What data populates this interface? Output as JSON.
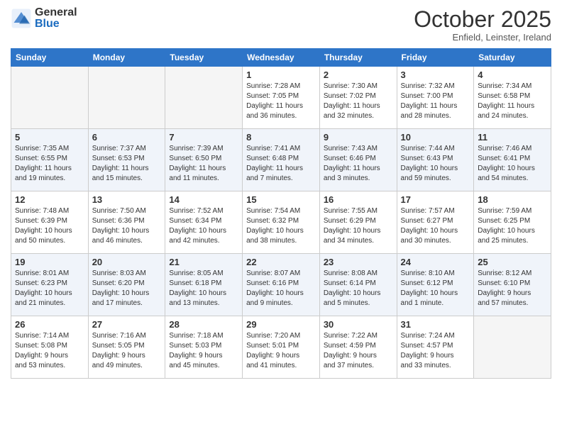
{
  "logo": {
    "general": "General",
    "blue": "Blue"
  },
  "title": "October 2025",
  "location": "Enfield, Leinster, Ireland",
  "days_of_week": [
    "Sunday",
    "Monday",
    "Tuesday",
    "Wednesday",
    "Thursday",
    "Friday",
    "Saturday"
  ],
  "weeks": [
    [
      {
        "day": "",
        "info": ""
      },
      {
        "day": "",
        "info": ""
      },
      {
        "day": "",
        "info": ""
      },
      {
        "day": "1",
        "info": "Sunrise: 7:28 AM\nSunset: 7:05 PM\nDaylight: 11 hours\nand 36 minutes."
      },
      {
        "day": "2",
        "info": "Sunrise: 7:30 AM\nSunset: 7:02 PM\nDaylight: 11 hours\nand 32 minutes."
      },
      {
        "day": "3",
        "info": "Sunrise: 7:32 AM\nSunset: 7:00 PM\nDaylight: 11 hours\nand 28 minutes."
      },
      {
        "day": "4",
        "info": "Sunrise: 7:34 AM\nSunset: 6:58 PM\nDaylight: 11 hours\nand 24 minutes."
      }
    ],
    [
      {
        "day": "5",
        "info": "Sunrise: 7:35 AM\nSunset: 6:55 PM\nDaylight: 11 hours\nand 19 minutes."
      },
      {
        "day": "6",
        "info": "Sunrise: 7:37 AM\nSunset: 6:53 PM\nDaylight: 11 hours\nand 15 minutes."
      },
      {
        "day": "7",
        "info": "Sunrise: 7:39 AM\nSunset: 6:50 PM\nDaylight: 11 hours\nand 11 minutes."
      },
      {
        "day": "8",
        "info": "Sunrise: 7:41 AM\nSunset: 6:48 PM\nDaylight: 11 hours\nand 7 minutes."
      },
      {
        "day": "9",
        "info": "Sunrise: 7:43 AM\nSunset: 6:46 PM\nDaylight: 11 hours\nand 3 minutes."
      },
      {
        "day": "10",
        "info": "Sunrise: 7:44 AM\nSunset: 6:43 PM\nDaylight: 10 hours\nand 59 minutes."
      },
      {
        "day": "11",
        "info": "Sunrise: 7:46 AM\nSunset: 6:41 PM\nDaylight: 10 hours\nand 54 minutes."
      }
    ],
    [
      {
        "day": "12",
        "info": "Sunrise: 7:48 AM\nSunset: 6:39 PM\nDaylight: 10 hours\nand 50 minutes."
      },
      {
        "day": "13",
        "info": "Sunrise: 7:50 AM\nSunset: 6:36 PM\nDaylight: 10 hours\nand 46 minutes."
      },
      {
        "day": "14",
        "info": "Sunrise: 7:52 AM\nSunset: 6:34 PM\nDaylight: 10 hours\nand 42 minutes."
      },
      {
        "day": "15",
        "info": "Sunrise: 7:54 AM\nSunset: 6:32 PM\nDaylight: 10 hours\nand 38 minutes."
      },
      {
        "day": "16",
        "info": "Sunrise: 7:55 AM\nSunset: 6:29 PM\nDaylight: 10 hours\nand 34 minutes."
      },
      {
        "day": "17",
        "info": "Sunrise: 7:57 AM\nSunset: 6:27 PM\nDaylight: 10 hours\nand 30 minutes."
      },
      {
        "day": "18",
        "info": "Sunrise: 7:59 AM\nSunset: 6:25 PM\nDaylight: 10 hours\nand 25 minutes."
      }
    ],
    [
      {
        "day": "19",
        "info": "Sunrise: 8:01 AM\nSunset: 6:23 PM\nDaylight: 10 hours\nand 21 minutes."
      },
      {
        "day": "20",
        "info": "Sunrise: 8:03 AM\nSunset: 6:20 PM\nDaylight: 10 hours\nand 17 minutes."
      },
      {
        "day": "21",
        "info": "Sunrise: 8:05 AM\nSunset: 6:18 PM\nDaylight: 10 hours\nand 13 minutes."
      },
      {
        "day": "22",
        "info": "Sunrise: 8:07 AM\nSunset: 6:16 PM\nDaylight: 10 hours\nand 9 minutes."
      },
      {
        "day": "23",
        "info": "Sunrise: 8:08 AM\nSunset: 6:14 PM\nDaylight: 10 hours\nand 5 minutes."
      },
      {
        "day": "24",
        "info": "Sunrise: 8:10 AM\nSunset: 6:12 PM\nDaylight: 10 hours\nand 1 minute."
      },
      {
        "day": "25",
        "info": "Sunrise: 8:12 AM\nSunset: 6:10 PM\nDaylight: 9 hours\nand 57 minutes."
      }
    ],
    [
      {
        "day": "26",
        "info": "Sunrise: 7:14 AM\nSunset: 5:08 PM\nDaylight: 9 hours\nand 53 minutes."
      },
      {
        "day": "27",
        "info": "Sunrise: 7:16 AM\nSunset: 5:05 PM\nDaylight: 9 hours\nand 49 minutes."
      },
      {
        "day": "28",
        "info": "Sunrise: 7:18 AM\nSunset: 5:03 PM\nDaylight: 9 hours\nand 45 minutes."
      },
      {
        "day": "29",
        "info": "Sunrise: 7:20 AM\nSunset: 5:01 PM\nDaylight: 9 hours\nand 41 minutes."
      },
      {
        "day": "30",
        "info": "Sunrise: 7:22 AM\nSunset: 4:59 PM\nDaylight: 9 hours\nand 37 minutes."
      },
      {
        "day": "31",
        "info": "Sunrise: 7:24 AM\nSunset: 4:57 PM\nDaylight: 9 hours\nand 33 minutes."
      },
      {
        "day": "",
        "info": ""
      }
    ]
  ]
}
